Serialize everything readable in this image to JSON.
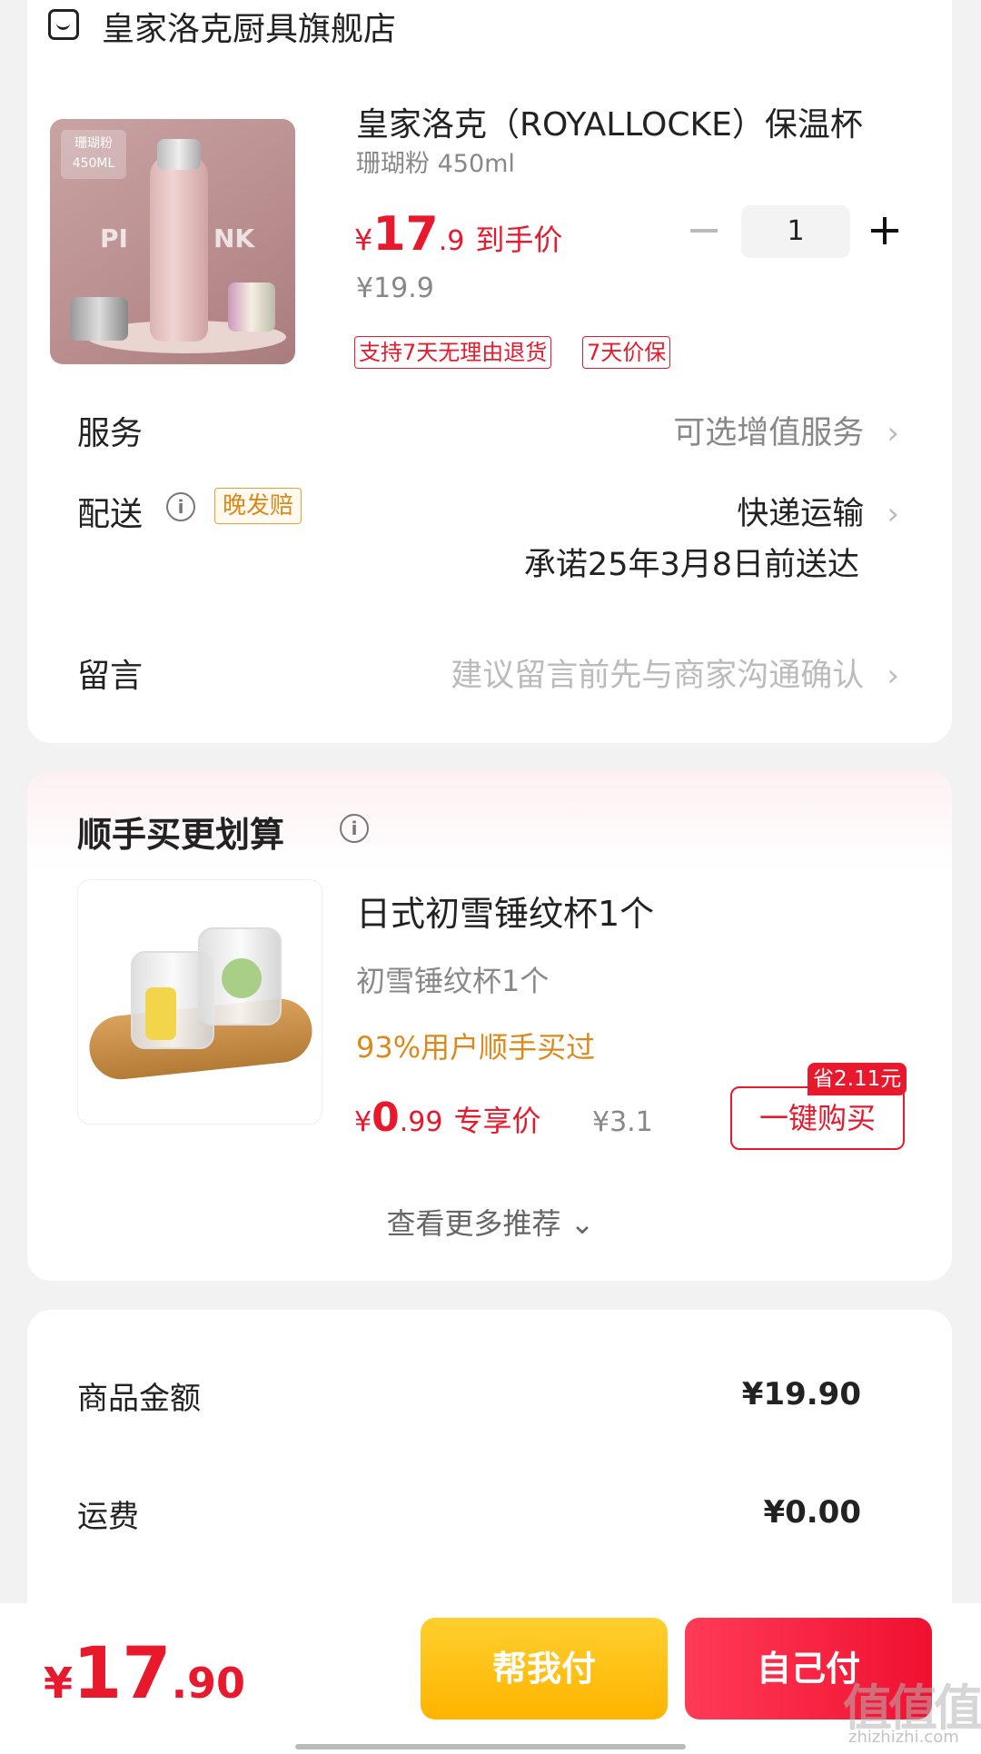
{
  "store": {
    "name": "皇家洛克厨具旗舰店",
    "icon": "store-icon"
  },
  "product": {
    "title": "皇家洛克（ROYALLOCKE）保温杯",
    "spec": "珊瑚粉 450ml",
    "price_yen": "¥",
    "price_int": "17",
    "price_dec": ".9",
    "price_label": "到手价",
    "original_price": "¥19.9",
    "quantity": "1",
    "badges": [
      "支持7天无理由退货",
      "7天价保"
    ],
    "image_tag": "珊瑚粉 450ML",
    "image_word_left": "PI",
    "image_word_right": "NK"
  },
  "rows": {
    "service_label": "服务",
    "service_value": "可选增值服务",
    "delivery_label": "配送",
    "delivery_badge": "晚发赔",
    "delivery_value": "快递运输",
    "delivery_promise": "承诺25年3月8日前送达",
    "message_label": "留言",
    "message_placeholder": "建议留言前先与商家沟通确认",
    "chevron": "›"
  },
  "recommend": {
    "header": "顺手买更划算",
    "item_title": "日式初雪锤纹杯1个",
    "item_spec": "初雪锤纹杯1个",
    "item_stat": "93%用户顺手买过",
    "price_yen": "¥",
    "price_int": "0",
    "price_dec": ".99",
    "price_label": "专享价",
    "original_price": "¥3.1",
    "save_badge": "省2.11元",
    "buy_label": "一键购买",
    "more_label": "查看更多推荐 ⌄"
  },
  "summary": {
    "goods_label": "商品金额",
    "goods_value": "¥19.90",
    "shipping_label": "运费",
    "shipping_value": "¥0.00"
  },
  "bottom": {
    "total_yen": "¥",
    "total_int": "17",
    "total_dec": ".90",
    "pay_friend": "帮我付",
    "pay_self": "自己付"
  },
  "watermark": {
    "text": "值值值",
    "site": "zhizhizhi.com"
  },
  "colors": {
    "accent_red": "#e8192c",
    "accent_orange": "#d98a1b",
    "pay_yellow": "#ffb400"
  }
}
